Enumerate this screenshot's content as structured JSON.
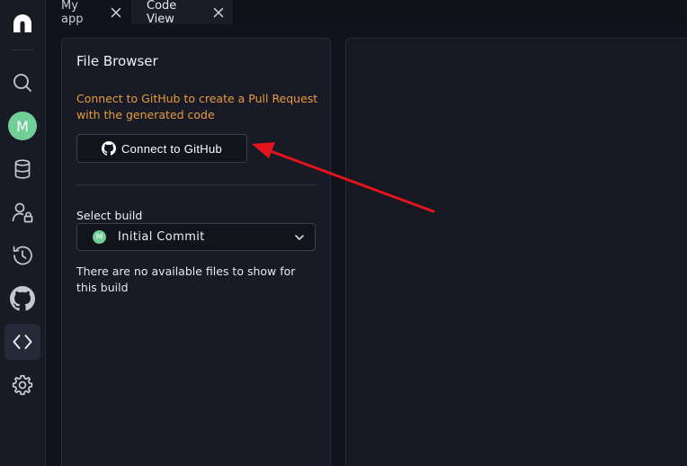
{
  "sidebar": {
    "avatar_initial": "M",
    "items": [
      {
        "icon": "logo-icon"
      },
      {
        "icon": "search-icon"
      },
      {
        "icon": "avatar"
      },
      {
        "icon": "database-icon"
      },
      {
        "icon": "user-lock-icon"
      },
      {
        "icon": "history-icon"
      },
      {
        "icon": "github-icon"
      },
      {
        "icon": "code-icon",
        "active": true
      },
      {
        "icon": "gear-icon"
      }
    ]
  },
  "tabs": [
    {
      "label": "My app",
      "active": false
    },
    {
      "label": "Code View",
      "active": true
    }
  ],
  "file_browser": {
    "title": "File Browser",
    "github_notice": "Connect to GitHub to create a Pull Request with the generated code",
    "connect_button_label": "Connect to GitHub",
    "select_build_label": "Select build",
    "selected_build": "Initial Commit",
    "selected_build_initial": "M",
    "empty_message": "There are no available files to show for this build"
  },
  "annotation": {
    "type": "arrow",
    "color": "#e3141b",
    "points_to": "connect-github-button"
  },
  "colors": {
    "accent_green": "#6fcf97",
    "notice_orange": "#e89a3c",
    "background": "#11131c"
  }
}
